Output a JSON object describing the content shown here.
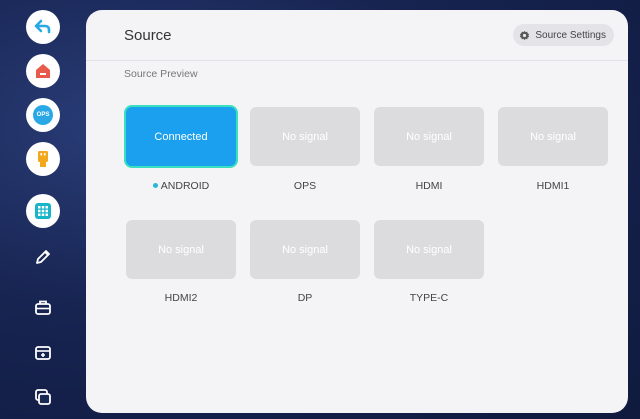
{
  "header": {
    "title": "Source",
    "settings_label": "Source Settings",
    "subtitle": "Source Preview"
  },
  "sidebar": {
    "items": [
      {
        "icon": "back-arrow-icon",
        "color": "#2aa8e6"
      },
      {
        "icon": "home-icon",
        "color": "#e85a4a"
      },
      {
        "icon": "ops-icon",
        "label": "OPS",
        "color": "#2aa8e6"
      },
      {
        "icon": "usb-icon",
        "color": "#f2a81d"
      },
      {
        "icon": "apps-grid-icon",
        "color": "#18b4c8"
      },
      {
        "icon": "pen-icon"
      },
      {
        "icon": "toolbox-icon"
      },
      {
        "icon": "screen-mirror-icon"
      },
      {
        "icon": "multi-window-icon"
      }
    ]
  },
  "sources": [
    {
      "name": "ANDROID",
      "status": "Connected",
      "active": true
    },
    {
      "name": "OPS",
      "status": "No signal",
      "active": false
    },
    {
      "name": "HDMI",
      "status": "No signal",
      "active": false
    },
    {
      "name": "HDMI1",
      "status": "No signal",
      "active": false
    },
    {
      "name": "HDMI2",
      "status": "No signal",
      "active": false
    },
    {
      "name": "DP",
      "status": "No signal",
      "active": false
    },
    {
      "name": "TYPE-C",
      "status": "No signal",
      "active": false
    }
  ],
  "colors": {
    "accent": "#1aa0ee",
    "active_outline": "#38e0c0",
    "inactive_tile": "#dcdcdf"
  }
}
